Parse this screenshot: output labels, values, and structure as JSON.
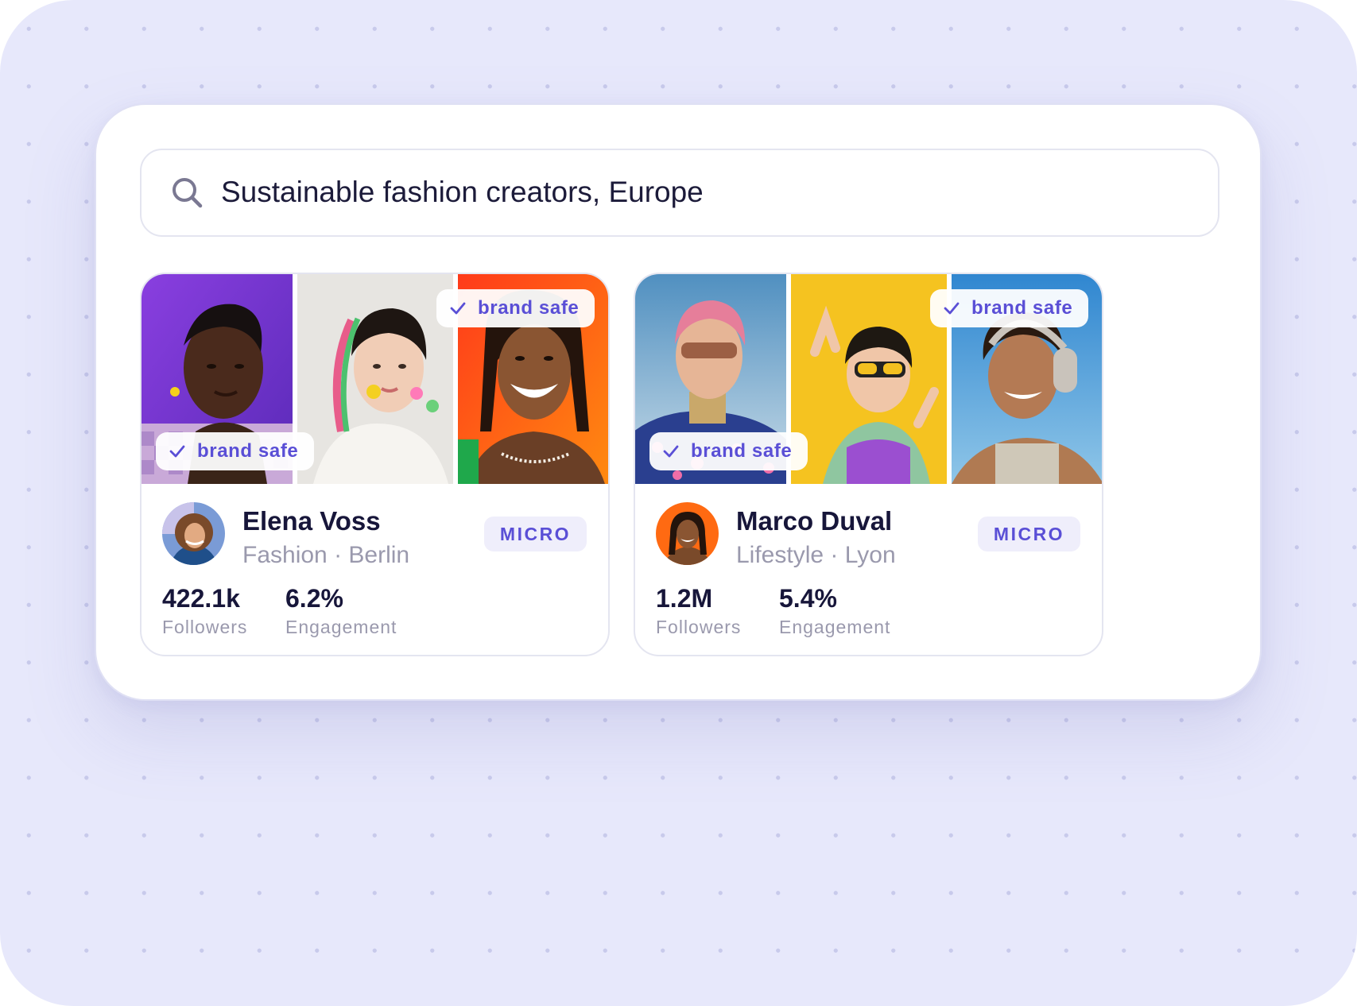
{
  "search": {
    "icon": "search-icon",
    "query": "Sustainable fashion creators, Europe"
  },
  "creators": [
    {
      "name": "Elena Voss",
      "category": "Fashion · Berlin",
      "tier": "MICRO",
      "followers": "422.1k",
      "followers_label": "Followers",
      "engagement": "6.2%",
      "engagement_label": "Engagement",
      "badges": [
        "brand safe",
        "brand safe"
      ],
      "badge_icon": "check-icon",
      "photo_backgrounds": [
        "#7b3fd8",
        "#e9e6e2",
        "#ff5a12"
      ]
    },
    {
      "name": "Marco Duval",
      "category": "Lifestyle · Lyon",
      "tier": "MICRO",
      "followers": "1.2M",
      "followers_label": "Followers",
      "engagement": "5.4%",
      "engagement_label": "Engagement",
      "badges": [
        "brand safe",
        "brand safe"
      ],
      "badge_icon": "check-icon",
      "photo_backgrounds": [
        "#5b93bf",
        "#f4c21e",
        "#3b92d4"
      ]
    }
  ],
  "colors": {
    "accent": "#5a4fd6",
    "background": "#e7e8fb",
    "text_primary": "#17163a",
    "text_muted": "#9a99ad"
  }
}
